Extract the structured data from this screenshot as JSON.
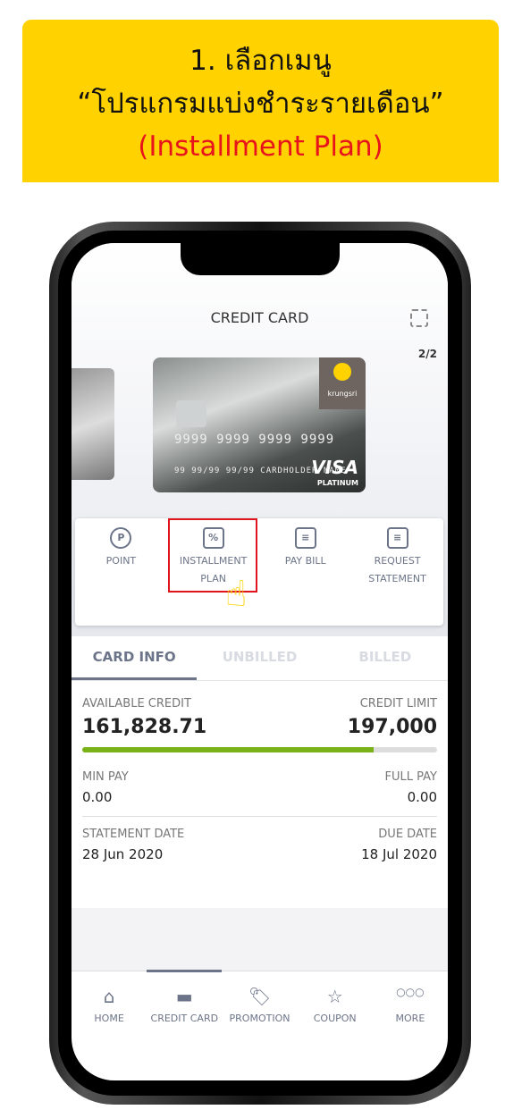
{
  "banner": {
    "line1": "1. เลือกเมนู",
    "line2": "“โปรแกรมแบ่งชำระรายเดือน”",
    "line3": "(Installment Plan)"
  },
  "header": {
    "title": "CREDIT CARD",
    "pager": "2/2"
  },
  "card": {
    "brand": "krungsri",
    "number": "9999 9999 9999 9999",
    "holder": "99  99/99  99/99  CARDHOLDER NAME",
    "network": "VISA",
    "tier": "PLATINUM"
  },
  "menu": [
    {
      "label": "POINT",
      "icon": "P"
    },
    {
      "label": "INSTALLMENT PLAN",
      "icon": "%"
    },
    {
      "label": "PAY BILL",
      "icon": "≡"
    },
    {
      "label": "REQUEST STATEMENT",
      "icon": "≡"
    }
  ],
  "tabs": [
    "CARD INFO",
    "UNBILLED",
    "BILLED"
  ],
  "info": {
    "available_label": "AVAILABLE CREDIT",
    "available": "161,828.71",
    "limit_label": "CREDIT LIMIT",
    "limit": "197,000",
    "usage_pct": 82,
    "min_label": "MIN PAY",
    "min": "0.00",
    "full_label": "FULL PAY",
    "full": "0.00",
    "stmt_label": "STATEMENT DATE",
    "stmt": "28 Jun 2020",
    "due_label": "DUE DATE",
    "due": "18 Jul 2020"
  },
  "nav": [
    {
      "label": "HOME",
      "icon": "⌂"
    },
    {
      "label": "CREDIT CARD",
      "icon": "▬"
    },
    {
      "label": "PROMOTION",
      "icon": "🏷"
    },
    {
      "label": "COUPON",
      "icon": "☆"
    },
    {
      "label": "MORE",
      "icon": "○○○"
    }
  ],
  "colors": {
    "banner": "#FFD200",
    "highlight": "#E0141C",
    "progress": "#7AB317"
  }
}
